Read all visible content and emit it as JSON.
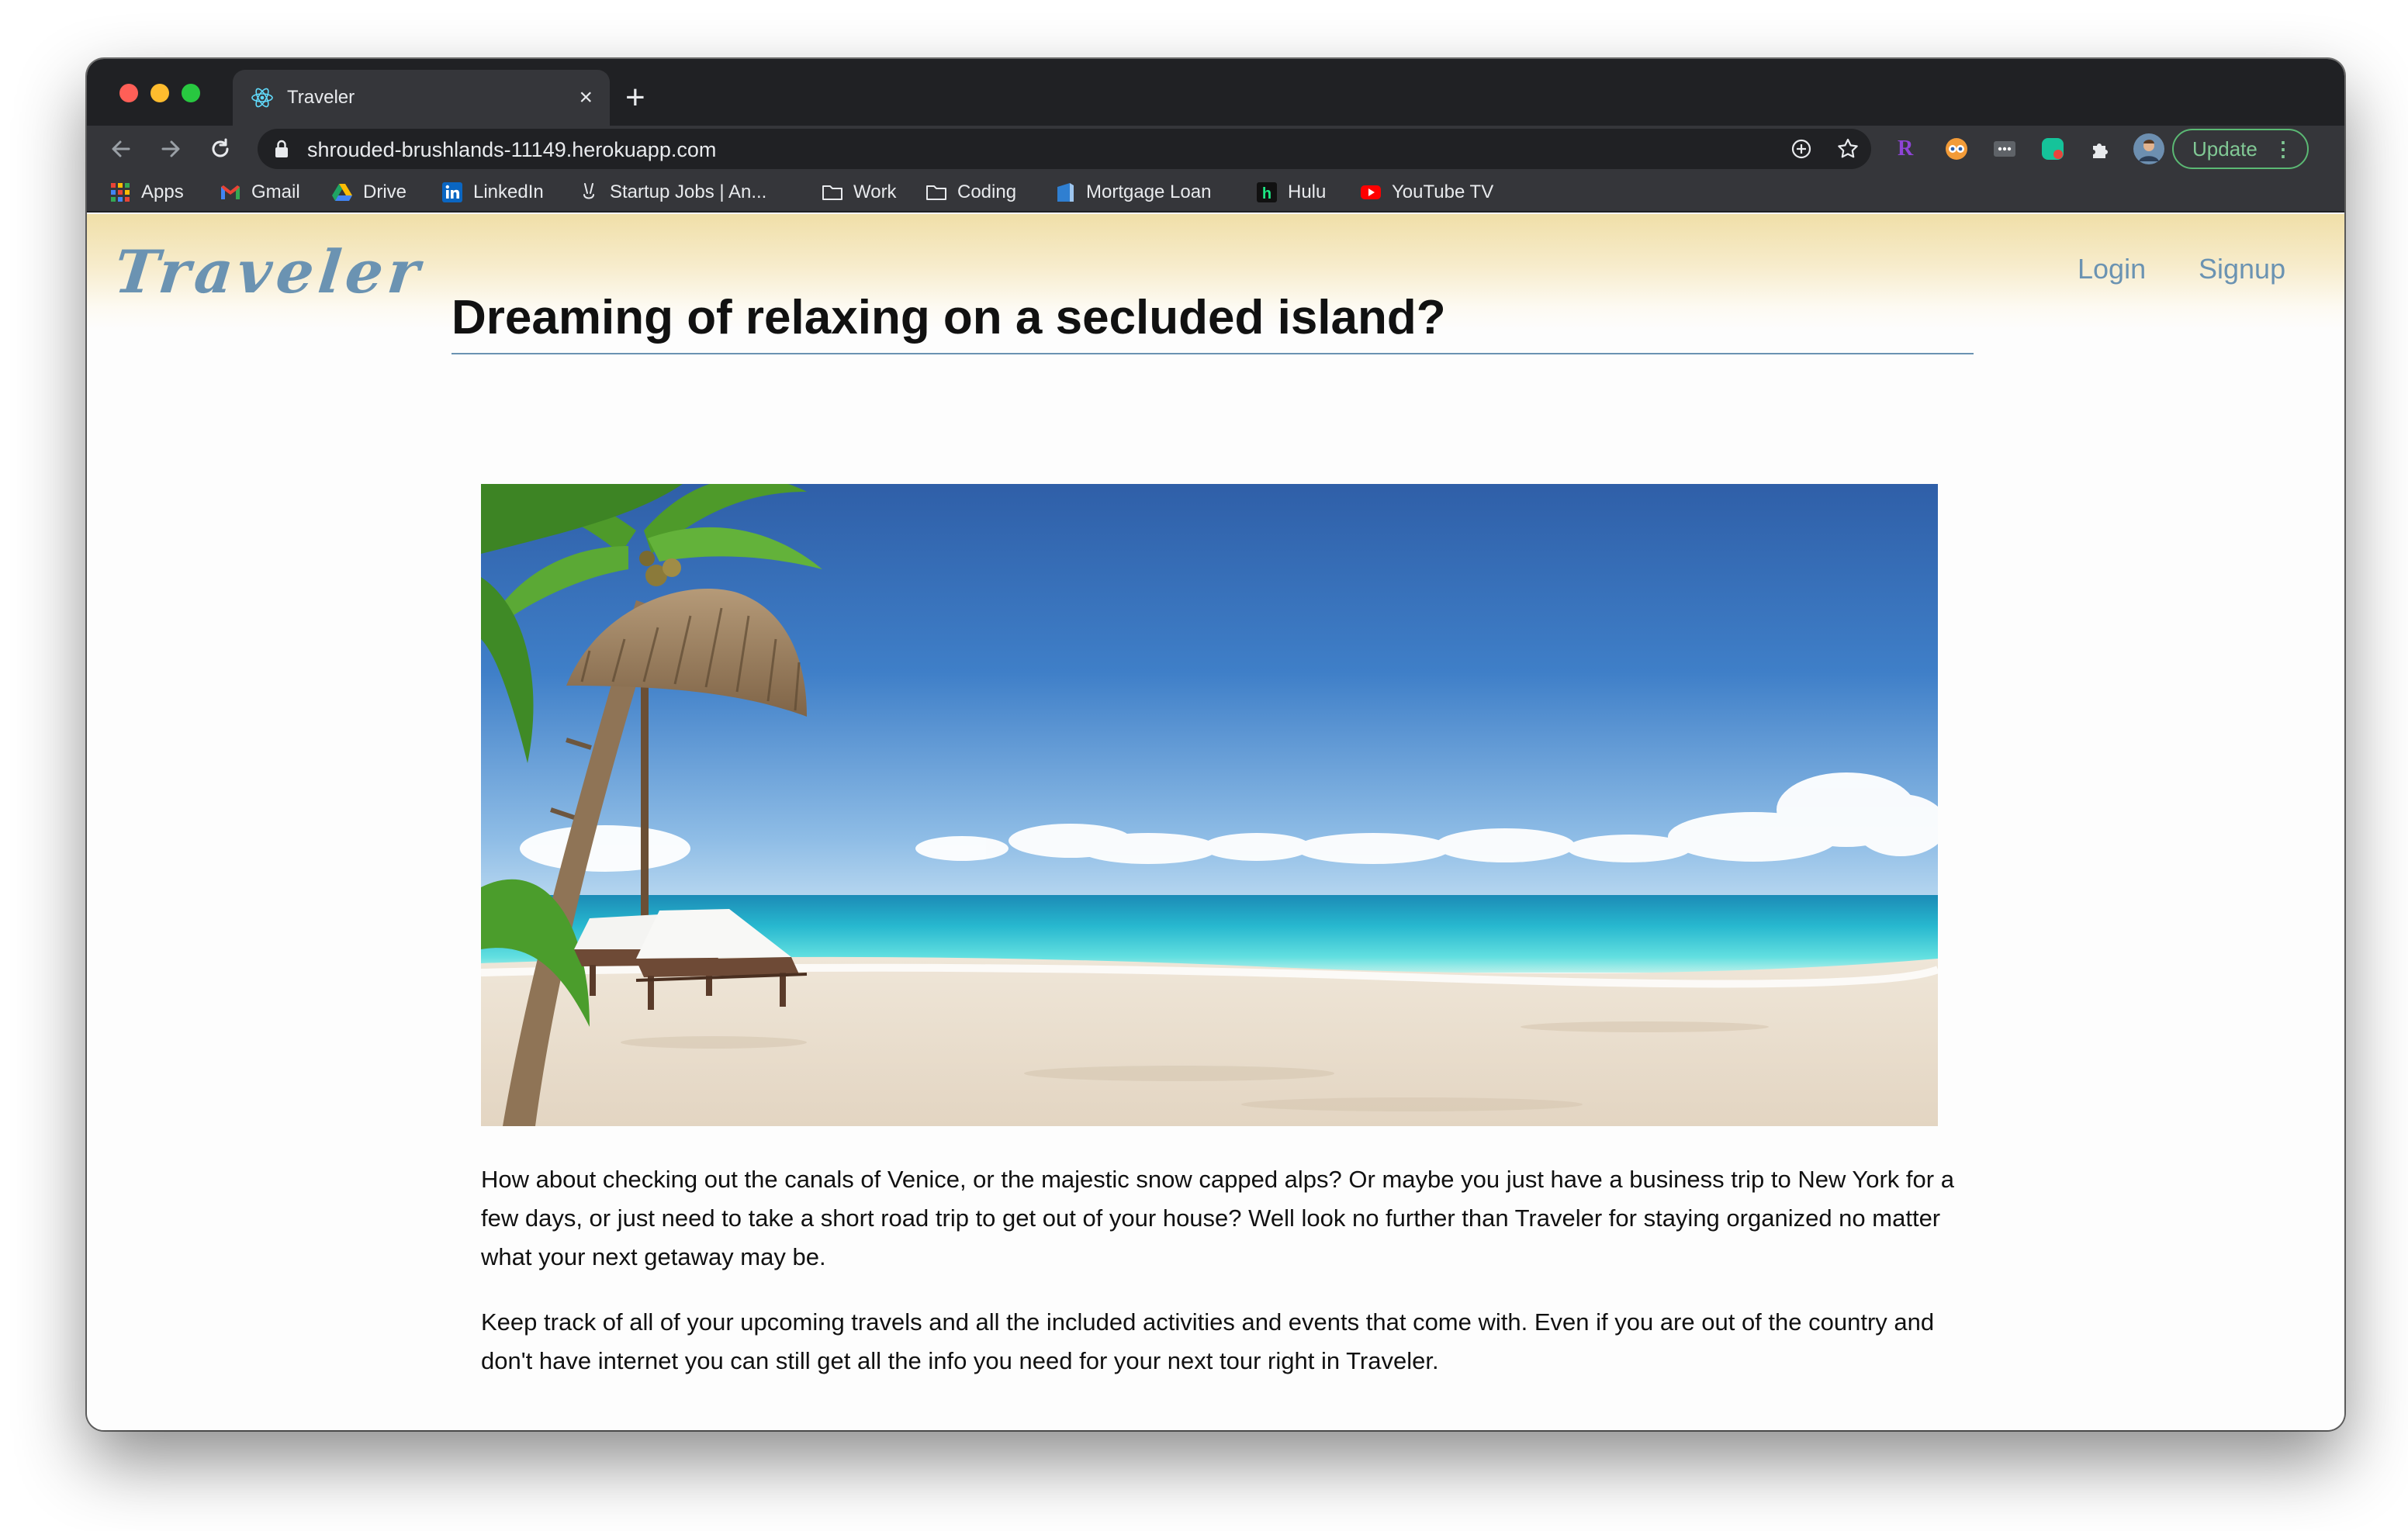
{
  "browser": {
    "tab": {
      "title": "Traveler",
      "favicon": "react-atom-icon"
    },
    "url": "shrouded-brushlands-11149.herokuapp.com",
    "update_label": "Update",
    "bookmarks": [
      {
        "label": "Apps",
        "icon": "apps-grid-icon"
      },
      {
        "label": "Gmail",
        "icon": "gmail-icon"
      },
      {
        "label": "Drive",
        "icon": "drive-icon"
      },
      {
        "label": "LinkedIn",
        "icon": "linkedin-icon"
      },
      {
        "label": "Startup Jobs | An...",
        "icon": "startup-jobs-icon"
      },
      {
        "label": "Work",
        "icon": "folder-icon"
      },
      {
        "label": "Coding",
        "icon": "folder-icon"
      },
      {
        "label": "Mortgage Loan",
        "icon": "mortgage-icon"
      },
      {
        "label": "Hulu",
        "icon": "hulu-icon"
      },
      {
        "label": "YouTube TV",
        "icon": "youtube-tv-icon"
      }
    ],
    "colors": {
      "frame": "#202124",
      "toolbar": "#35363a",
      "update_accent": "#81c995"
    }
  },
  "site": {
    "logo": "Traveler",
    "nav": {
      "login": "Login",
      "signup": "Signup"
    },
    "headline": "Dreaming of relaxing on a secluded island?",
    "hero_alt": "tropical beach with thatched umbrella and lounge chairs",
    "paragraphs": [
      "How about checking out the canals of Venice, or the majestic snow capped alps? Or maybe you just have a business trip to New York for a few days, or just need to take a short road trip to get out of your house? Well look no further than Traveler for staying organized no matter what your next getaway may be.",
      "Keep track of all of your upcoming travels and all the included activities and events that come with. Even if you are out of the country and don't have internet you can still get all the info you need for your next tour right in Traveler."
    ],
    "colors": {
      "brand": "#6b93b2",
      "header_gradient_top": "#f0dfa8"
    }
  }
}
